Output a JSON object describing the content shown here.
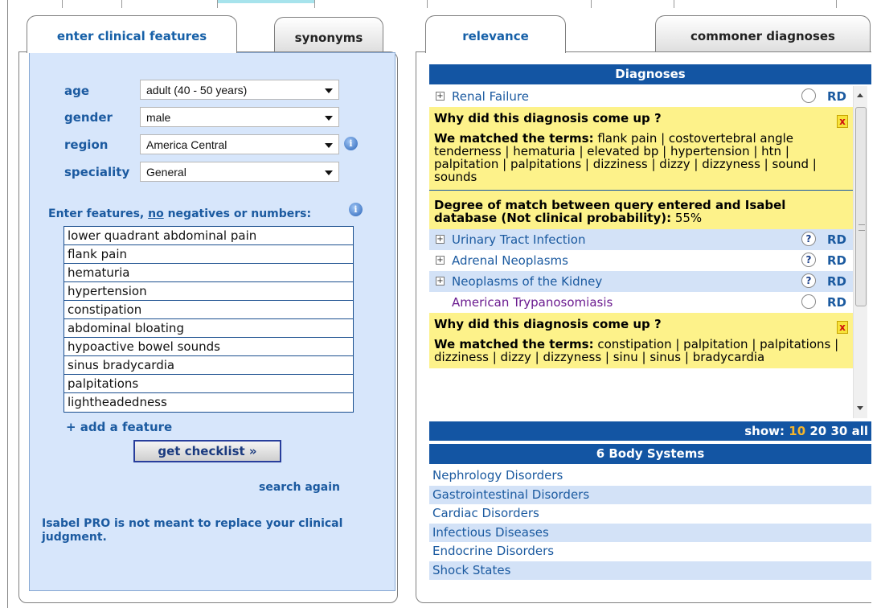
{
  "left_tabs": {
    "active": "enter clinical features",
    "inactive": "synonyms"
  },
  "right_tabs": {
    "active": "relevance",
    "inactive": "commoner diagnoses"
  },
  "form": {
    "age_label": "age",
    "age_value": "adult (40 - 50 years)",
    "gender_label": "gender",
    "gender_value": "male",
    "region_label": "region",
    "region_value": "America Central",
    "speciality_label": "speciality",
    "speciality_value": "General"
  },
  "features": {
    "heading_pre": "Enter features, ",
    "heading_no": "no",
    "heading_post": " negatives or numbers:",
    "items": [
      "lower quadrant abdominal pain",
      "flank pain",
      "hematuria",
      "hypertension",
      "constipation",
      "abdominal bloating",
      "hypoactive bowel sounds",
      "sinus bradycardia",
      "palpitations",
      "lightheadedness"
    ],
    "add_label": "+ add a feature",
    "checklist_button": "get checklist »",
    "search_again": "search again",
    "disclaimer": "Isabel PRO is not meant to replace your clinical judgment."
  },
  "diagnoses": {
    "header": "Diagnoses",
    "rd_label": "RD",
    "why_title": "Why did this diagnosis come up ?",
    "matched_label": "We matched the terms:",
    "rows": [
      {
        "name": "Renal Failure",
        "expandable": true,
        "marker": ""
      },
      {
        "name": "Urinary Tract Infection",
        "expandable": true,
        "marker": "?"
      },
      {
        "name": "Adrenal Neoplasms",
        "expandable": true,
        "marker": "?"
      },
      {
        "name": "Neoplasms of the Kidney",
        "expandable": true,
        "marker": "?"
      },
      {
        "name": "American Trypanosomiasis",
        "expandable": false,
        "marker": ""
      }
    ],
    "why1_terms": " flank pain | costovertebral angle tenderness | hematuria | elevated bp | hypertension | htn | palpitation | palpitations | dizziness | dizzy | dizzyness | sound | sounds",
    "degree_label": "Degree of match between query entered and Isabel database (Not clinical probability):",
    "degree_value": " 55%",
    "why2_terms": " constipation | palpitation | palpitations | dizziness | dizzy | dizzyness | sinu | sinus | bradycardia",
    "close_label": "x"
  },
  "show": {
    "label": "show:",
    "options": [
      "10",
      "20",
      "30",
      "all"
    ],
    "current": "10"
  },
  "body_systems": {
    "header": "6 Body Systems",
    "items": [
      "Nephrology Disorders",
      "Gastrointestinal Disorders",
      "Cardiac Disorders",
      "Infectious Diseases",
      "Endocrine Disorders",
      "Shock States"
    ]
  },
  "colors": {
    "accent": "#1355a3",
    "panel_bg": "#d7e6fb",
    "highlight": "#fdf28a",
    "link": "#1b5aa0"
  }
}
